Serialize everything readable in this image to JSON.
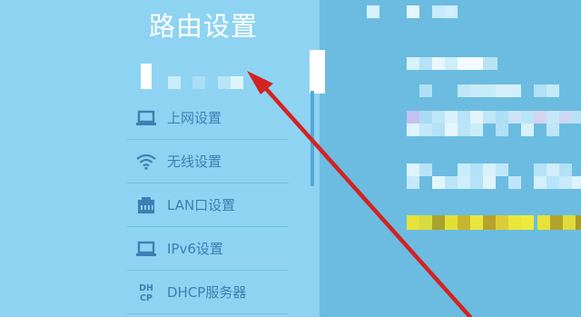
{
  "sidebar": {
    "title": "路由设置",
    "items": [
      {
        "label": "上网设置",
        "icon": "laptop-icon"
      },
      {
        "label": "无线设置",
        "icon": "wifi-icon"
      },
      {
        "label": "LAN口设置",
        "icon": "lan-port-icon"
      },
      {
        "label": "IPv6设置",
        "icon": "laptop-icon"
      },
      {
        "label": "DHCP服务器",
        "icon": "dhcp-icon"
      }
    ]
  },
  "colors": {
    "sidebar_bg": "#8ed3f2",
    "content_bg": "#6bbce0",
    "menu_text": "#3d7fb3",
    "arrow": "#d32222"
  }
}
